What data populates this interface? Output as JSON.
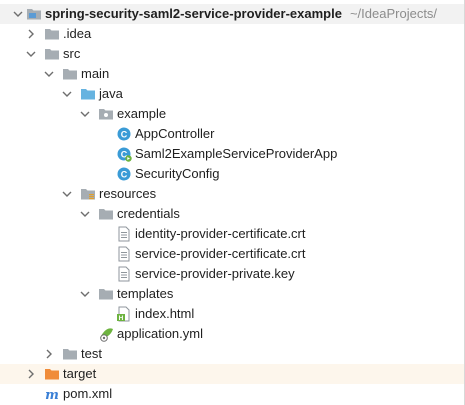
{
  "tree": {
    "root": {
      "name": "spring-security-saml2-service-provider-example",
      "path_hint": "~/IdeaProjects/"
    },
    "items": [
      {
        "label": ".idea"
      },
      {
        "label": "src"
      },
      {
        "label": "main"
      },
      {
        "label": "java"
      },
      {
        "label": "example"
      },
      {
        "label": "AppController"
      },
      {
        "label": "Saml2ExampleServiceProviderApp"
      },
      {
        "label": "SecurityConfig"
      },
      {
        "label": "resources"
      },
      {
        "label": "credentials"
      },
      {
        "label": "identity-provider-certificate.crt"
      },
      {
        "label": "service-provider-certificate.crt"
      },
      {
        "label": "service-provider-private.key"
      },
      {
        "label": "templates"
      },
      {
        "label": "index.html"
      },
      {
        "label": "application.yml"
      },
      {
        "label": "test"
      },
      {
        "label": "target"
      },
      {
        "label": "pom.xml"
      }
    ]
  },
  "icons": {
    "folder": "folder-icon",
    "source_folder": "source-folder-icon",
    "resources_folder": "resources-folder-icon",
    "package": "package-icon",
    "java_class": "java-class-icon",
    "spring_app": "spring-boot-app-icon",
    "text_file": "text-file-icon",
    "html_file": "html-file-icon",
    "yaml_file": "spring-yaml-icon",
    "maven_file": "maven-icon"
  },
  "colors": {
    "folder": "#a6adb3",
    "folder_dark": "#8f969c",
    "source_folder": "#66b3e0",
    "resources_folder": "#a6adb3",
    "excluded_folder": "#f08c3a",
    "class_circle": "#3a9bd6",
    "spring_green": "#6db33f",
    "maven_blue": "#3a7fd5",
    "chevron": "#6e6e6e"
  }
}
